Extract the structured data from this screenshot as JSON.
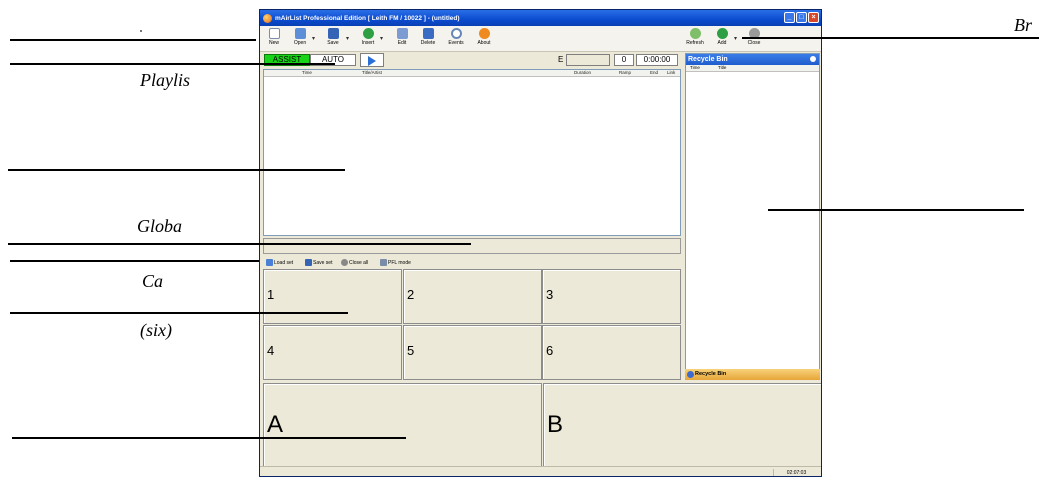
{
  "annotations": {
    "playlist": "Playlis",
    "global": "Globa",
    "carts": "Ca",
    "six": "(six)",
    "browser": "Br"
  },
  "window": {
    "title": "mAirList Professional Edition [ Leith FM / 10022 ] - (untitled)",
    "controls": [
      "_",
      "□",
      "×"
    ]
  },
  "toolbar": {
    "new": "New",
    "open": "Open",
    "save": "Save",
    "insert": "Insert",
    "edit": "Edit",
    "delete": "Delete",
    "events": "Events",
    "about": "About",
    "refresh": "Refresh",
    "add": "Add",
    "close": "Close"
  },
  "playlist": {
    "assist": "ASSIST",
    "auto": "AUTO",
    "e_label": "E",
    "count": "0",
    "time": "0:00:00",
    "columns": {
      "time": "Time",
      "title_artist": "Title/Artist",
      "duration": "Duration",
      "ramp": "Ramp",
      "end": "End",
      "link": "Link"
    }
  },
  "cartwall": {
    "load_set": "Load set",
    "save_set": "Save set",
    "close_all": "Close all",
    "pfl_mode": "PFL mode",
    "carts": [
      "1",
      "2",
      "3",
      "4",
      "5",
      "6"
    ]
  },
  "players": [
    "A",
    "B"
  ],
  "recycle_bin": {
    "title": "Recycle Bin",
    "col_time": "Time",
    "col_title": "Title",
    "footer": "Recycle Bin"
  },
  "status": {
    "clock": "02:07:03"
  }
}
